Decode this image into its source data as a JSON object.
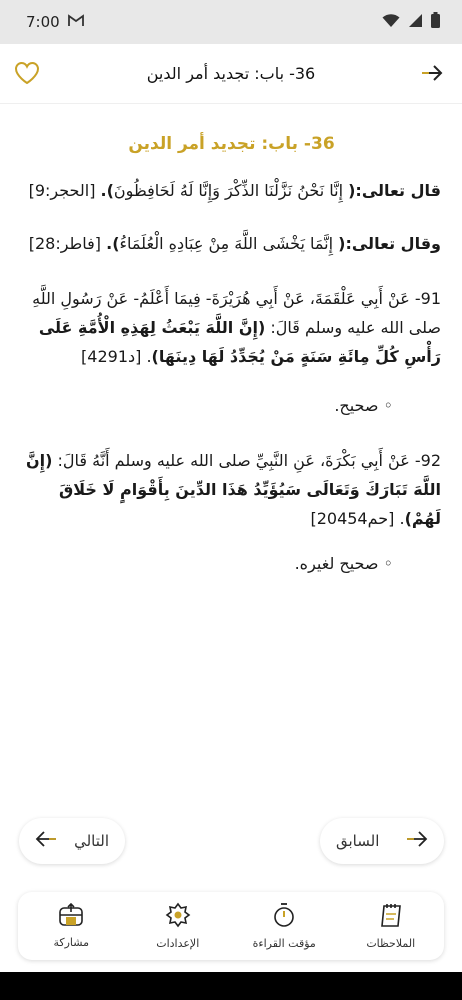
{
  "status_bar": {
    "time": "7:00",
    "mail_icon": "gmail-icon",
    "wifi_icon": "wifi-icon",
    "signal_icon": "signal-icon",
    "battery_icon": "battery-icon"
  },
  "header": {
    "title": "36- باب: تجديد أمر الدين",
    "back_icon": "arrow-right-icon",
    "favorite_icon": "heart-icon"
  },
  "chapter": {
    "title": "36- باب: تجديد أمر الدين",
    "verse1": {
      "intro": "قال تعالى:(",
      "text": " إِنَّا نَحْنُ نَزَّلْنَا الذِّكْرَ وَإِنَّا لَهُ لَحَافِظُونَ",
      "close": ").",
      "ref": " [الحجر:9]"
    },
    "verse2": {
      "intro": "وقال تعالى:(",
      "text": " إِنَّمَا يَخْشَى اللَّهَ مِنْ عِبَادِهِ الْعُلَمَاءُ",
      "close": ").",
      "ref": " [فاطر:28]"
    },
    "hadith91": {
      "chain": "91- عَنْ أَبِي عَلْقَمَةَ، عَنْ أَبِي هُرَيْرَةَ- فِيمَا أَعْلَمُ- عَنْ رَسُولِ اللَّهِ صلى الله عليه وسلم قَالَ: ",
      "matn": "(إِنَّ اللَّهَ يَبْعَثُ لِهَذِهِ الْأُمَّةِ عَلَى رَأْسِ كُلِّ مِائَةِ سَنَةٍ مَنْ يُجَدِّدُ لَهَا دِينَهَا)",
      "ref": ". [د4291]",
      "grade": "◦ صحيح."
    },
    "hadith92": {
      "chain": "92- عَنْ أَبِي بَكْرَةَ، عَنِ النَّبِيِّ صلى الله عليه وسلم أَنَّهُ قَالَ: ",
      "matn": "(إِنَّ اللَّهَ تَبَارَكَ وَتَعَالَى سَيُؤَيِّدُ هَذَا الدِّينَ بِأَقْوَامٍ لَا خَلَاقَ لَهُمْ)",
      "ref": ". [حم20454]",
      "grade": "◦ صحيح لغيره."
    }
  },
  "navigation": {
    "next_label": "التالي",
    "previous_label": "السابق"
  },
  "bottom_bar": {
    "items": [
      {
        "label": "مشاركة",
        "icon": "share-icon"
      },
      {
        "label": "الإعدادات",
        "icon": "settings-icon"
      },
      {
        "label": "مؤقت القراءة",
        "icon": "timer-icon"
      },
      {
        "label": "الملاحظات",
        "icon": "notes-icon"
      }
    ]
  },
  "colors": {
    "accent": "#c9a227",
    "text": "#1a1a1a",
    "status_bar_bg": "#e8e8e8"
  }
}
